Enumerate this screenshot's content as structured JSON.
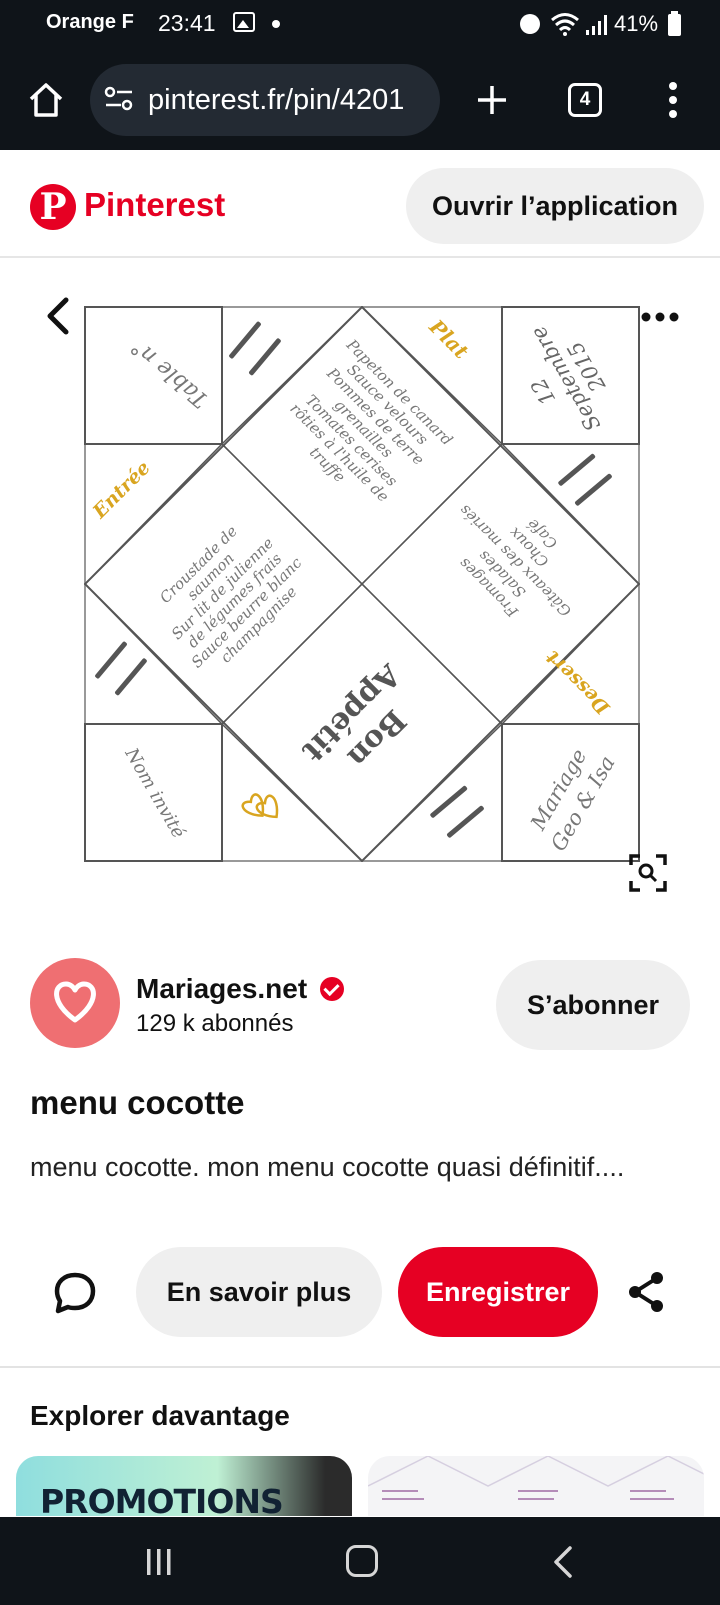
{
  "status_bar": {
    "carrier": "Orange F",
    "time": "23:41",
    "battery": "41%"
  },
  "browser": {
    "url": "pinterest.fr/pin/4201",
    "tab_count": "4"
  },
  "header": {
    "brand": "Pinterest",
    "logo_letter": "P",
    "open_app_label": "Ouvrir l’application"
  },
  "pin_image": {
    "table": "Table n°",
    "date_line1": "12",
    "date_line2": "Septembre",
    "date_line3": "2015",
    "plat_title": "Plat",
    "plat_items": [
      "Papeton de canard",
      "Sauce velours",
      "Pommes de terre",
      "grenailles",
      "Tomates cerises",
      "rôties à l'huile de",
      "truffe"
    ],
    "entree_title": "Entrée",
    "entree_items": [
      "Croustade de",
      "saumon",
      "Sur lit de julienne",
      "de légumes frais",
      "Sauce beurre blanc",
      "champagnise"
    ],
    "dessert_title": "Dessert",
    "dessert_items": [
      "Fromages",
      "Salades",
      "Gâteaux des mariés",
      "Choux",
      "Café"
    ],
    "bon_appetit_1": "Bon",
    "bon_appetit_2": "Appétit",
    "guest": "Nom invité",
    "wedding_line1": "Mariage",
    "wedding_line2": "Geo & Isa"
  },
  "creator": {
    "name": "Mariages.net",
    "followers": "129 k abonnés",
    "follow_label": "S’abonner"
  },
  "pin": {
    "title": "menu cocotte",
    "description": "menu cocotte. mon menu cocotte quasi définitif...."
  },
  "actions": {
    "more_info_label": "En savoir plus",
    "save_label": "Enregistrer"
  },
  "explore": {
    "title": "Explorer davantage",
    "thumb_left_text": "PROMOTIONS"
  },
  "colors": {
    "pinterest_red": "#e60023",
    "gold": "#d9a520",
    "dark_bar": "#0f1419"
  }
}
